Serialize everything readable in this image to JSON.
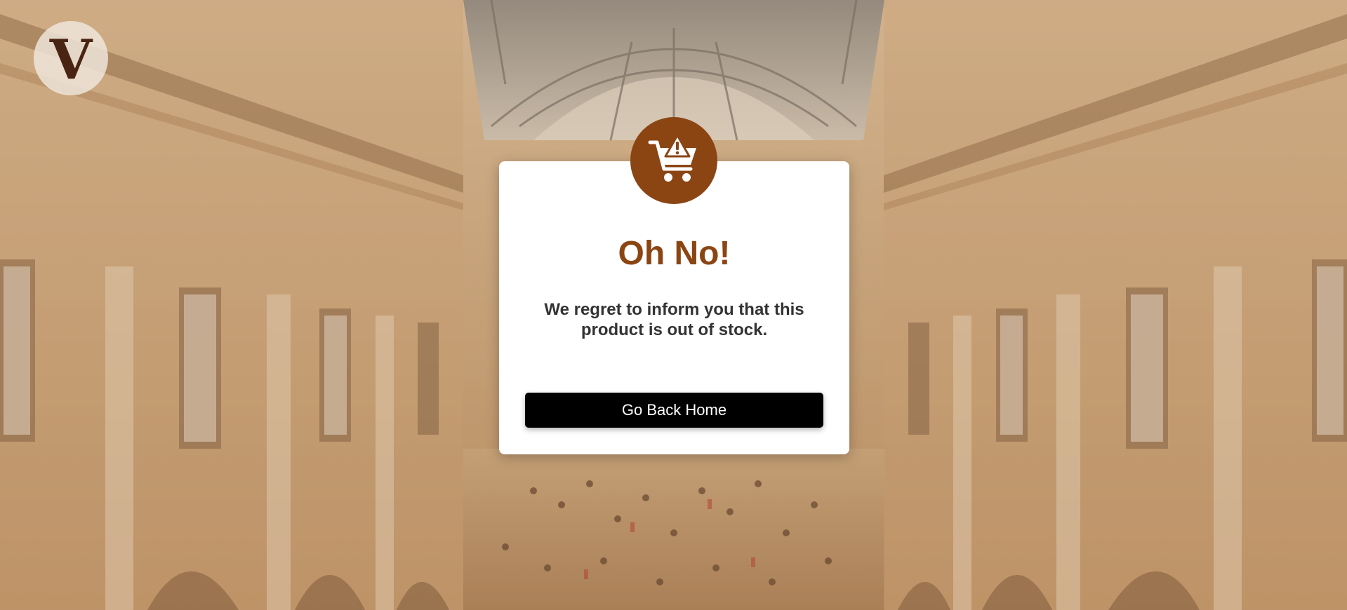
{
  "background": {
    "description_icon": "shopping-gallery-background",
    "overlay_color": "#c9a77f"
  },
  "logo": {
    "letter": "V",
    "icon": "brand-logo-icon"
  },
  "modal": {
    "badge_icon": "cart-warning-icon",
    "badge_color": "#8b4513",
    "title": "Oh No!",
    "message": "We regret to inform you that this product is out of stock.",
    "button_label": "Go Back Home",
    "accent_color": "#8b4513"
  }
}
